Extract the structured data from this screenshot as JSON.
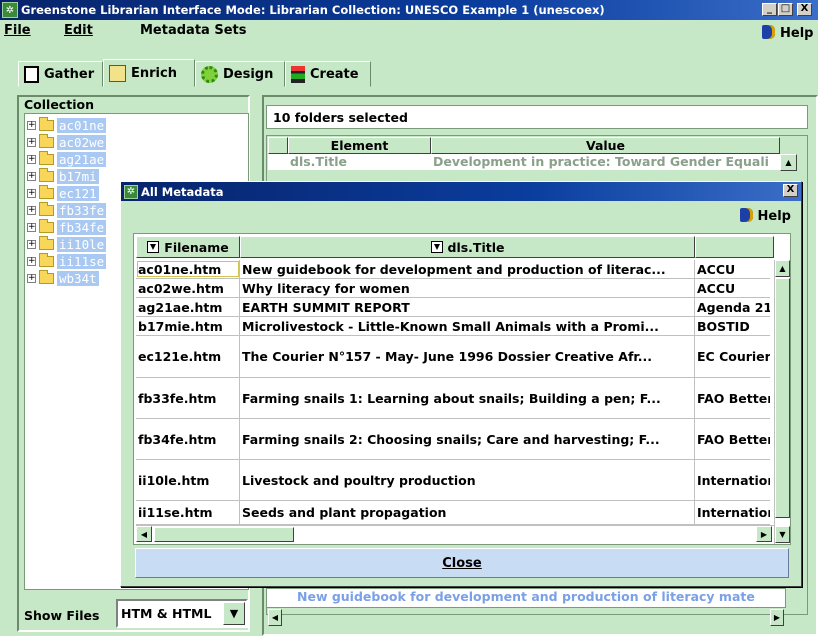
{
  "window": {
    "title": "Greenstone Librarian Interface Mode: Librarian  Collection: UNESCO Example 1 (unescoex)",
    "minimize": "_",
    "maximize": "□",
    "close": "X"
  },
  "menu": {
    "file": "File",
    "edit": "Edit",
    "metadata_sets": "Metadata Sets",
    "help": "Help"
  },
  "tabs": {
    "gather": "Gather",
    "enrich": "Enrich",
    "design": "Design",
    "create": "Create"
  },
  "collection": {
    "header": "Collection",
    "items": [
      "ac01ne",
      "ac02we",
      "ag21ae",
      "b17mi",
      "ec121",
      "fb33fe",
      "fb34fe",
      "ii10le",
      "ii11se",
      "wb34t"
    ],
    "toggle": "+"
  },
  "show_files": {
    "label": "Show Files",
    "value": "HTM & HTML",
    "arrow": "▼"
  },
  "right_panel": {
    "selection_text": "10 folders selected",
    "element_header": "Element",
    "value_header": "Value",
    "row_element": "dls.Title",
    "row_value": "Development in practice: Toward Gender Equali",
    "bottom_text": "New guidebook for development and production of literacy mate"
  },
  "dialog": {
    "title": "All Metadata",
    "close_x": "X",
    "help": "Help",
    "col_filename": "Filename",
    "col_title": "dls.Title",
    "rows": [
      {
        "filename": "ac01ne.htm",
        "title": "New guidebook for development and production of literac...",
        "publisher": "ACCU"
      },
      {
        "filename": "ac02we.htm",
        "title": "Why literacy for women",
        "publisher": "ACCU"
      },
      {
        "filename": "ag21ae.htm",
        "title": "EARTH SUMMIT REPORT",
        "publisher": "Agenda 21"
      },
      {
        "filename": "b17mie.htm",
        "title": "Microlivestock - Little-Known Small Animals with a Promi...",
        "publisher": "BOSTID"
      },
      {
        "filename": "ec121e.htm",
        "title": "The Courier N°157 - May- June 1996 Dossier Creative Afr...",
        "publisher": "EC Courier"
      },
      {
        "filename": "fb33fe.htm",
        "title": "Farming snails 1: Learning about snails; Building a pen; F...",
        "publisher": "FAO Better"
      },
      {
        "filename": "fb34fe.htm",
        "title": "Farming snails 2: Choosing snails; Care and harvesting; F...",
        "publisher": "FAO Better"
      },
      {
        "filename": "ii10le.htm",
        "title": "Livestock and poultry production",
        "publisher": "Internation"
      },
      {
        "filename": "ii11se.htm",
        "title": "Seeds and plant propagation",
        "publisher": "Internation"
      }
    ],
    "close_button": "Close"
  },
  "colors": {
    "background": "#c6e8c6",
    "titlebar": "#0a3d9e",
    "selection": "#a9c9f2",
    "close_button": "#c8dcf4"
  }
}
